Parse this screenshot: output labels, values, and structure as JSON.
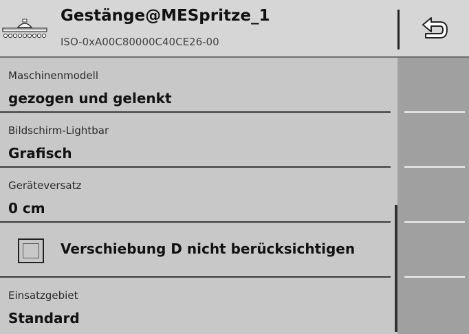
{
  "header": {
    "title": "Gestänge@MESpritze_1",
    "subtitle": "ISO-0xA00C80000C40CE26-00",
    "device_icon": "boom-sprayer-icon",
    "back_icon": "return-arrow-icon"
  },
  "settings": [
    {
      "label": "Maschinenmodell",
      "value": "gezogen und gelenkt"
    },
    {
      "label": "Bildschirm-Lightbar",
      "value": "Grafisch"
    },
    {
      "label": "Geräteversatz",
      "value": "0 cm"
    }
  ],
  "checkbox": {
    "label": "Verschiebung D nicht berücksichtigen",
    "checked": false
  },
  "settings_last": {
    "label": "Einsatzgebiet",
    "value": "Standard"
  }
}
